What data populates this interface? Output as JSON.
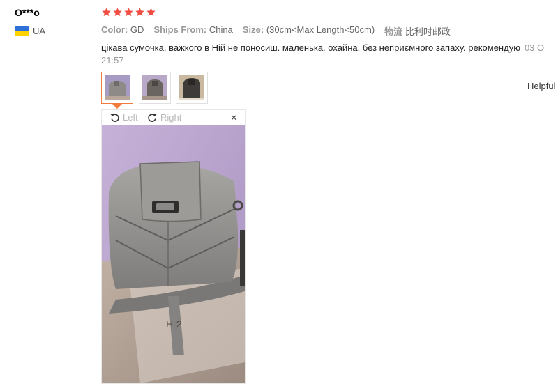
{
  "reviewer": {
    "name": "O***o",
    "country": "UA"
  },
  "rating": {
    "stars": 5,
    "max": 5,
    "color": "#f04e43"
  },
  "sku": [
    {
      "key": "Color:",
      "value": "GD"
    },
    {
      "key": "Ships From:",
      "value": "China"
    },
    {
      "key": "Size:",
      "value": "(30cm<Max Length<50cm)"
    },
    {
      "key": "物流",
      "value": "比利时邮政"
    }
  ],
  "review": {
    "text": "цікава сумочка. важкого в Ній не поносиш. маленька. охайна. без неприємного запаху. рекомендую",
    "date": "03 O",
    "time": "21:57"
  },
  "helpful_label": "Helpful",
  "viewer": {
    "rotate_left": "Left",
    "rotate_right": "Right",
    "close": "×"
  },
  "thumbnails": [
    {
      "active": true
    },
    {
      "active": false
    },
    {
      "active": false
    }
  ],
  "colors": {
    "accent": "#f27a3b",
    "flag_top": "#2e6fd8",
    "flag_bottom": "#ffd200"
  }
}
